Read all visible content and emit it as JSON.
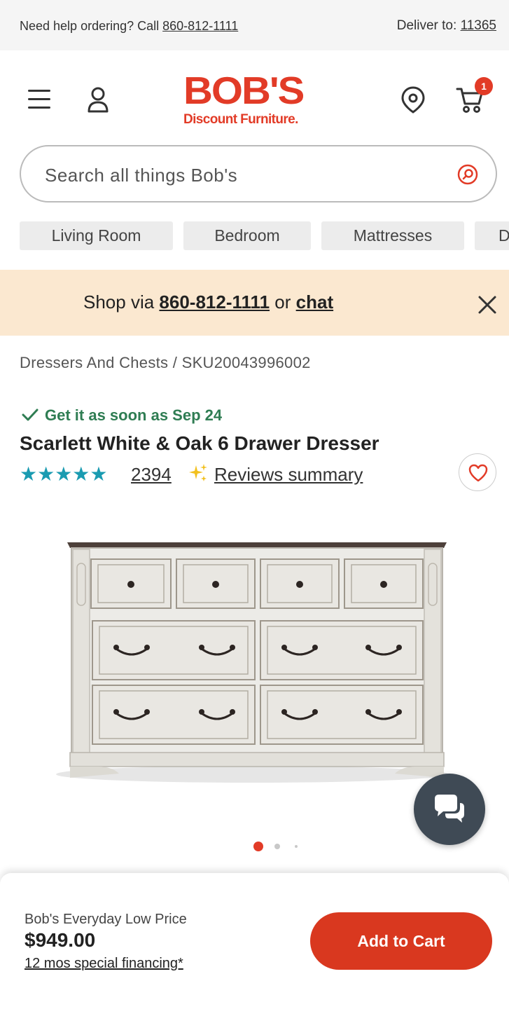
{
  "topbar": {
    "help_prefix": "Need help ordering? Call",
    "help_phone": "860-812-1111",
    "deliver_prefix": "Deliver to:",
    "deliver_zip": "11365"
  },
  "header": {
    "logo_main": "BOB'S",
    "logo_sub": "Discount Furniture.",
    "cart_count": "1",
    "menu_icon": "hamburger-menu-icon",
    "account_icon": "account-icon",
    "location_icon": "location-pin-icon",
    "cart_icon": "shopping-cart-icon"
  },
  "search": {
    "placeholder": "Search all things Bob's"
  },
  "categories": [
    {
      "label": "Living Room"
    },
    {
      "label": "Bedroom"
    },
    {
      "label": "Mattresses"
    },
    {
      "label": "D"
    }
  ],
  "banner": {
    "prefix": "Shop via",
    "phone": "860-812-1111",
    "middle": "or",
    "chat": "chat"
  },
  "breadcrumb": {
    "category": "Dressers And Chests",
    "separator": "/",
    "sku": "SKU20043996002"
  },
  "product": {
    "delivery": "Get it as soon as Sep 24",
    "title": "Scarlett White & Oak 6 Drawer Dresser",
    "stars": "★★★★★",
    "rating_value": 5,
    "review_count": "2394",
    "reviews_summary": "Reviews summary",
    "image_count": 3,
    "active_image": 1
  },
  "footer": {
    "price_label": "Bob's Everyday Low Price",
    "price": "$949.00",
    "financing": "12 mos special financing*",
    "add_to_cart": "Add to Cart"
  },
  "colors": {
    "brand_red": "#e23b27",
    "button_red": "#d9381f",
    "star_teal": "#1a9bb1",
    "delivery_green": "#2f7d53",
    "banner_bg": "#fbe8d0"
  }
}
